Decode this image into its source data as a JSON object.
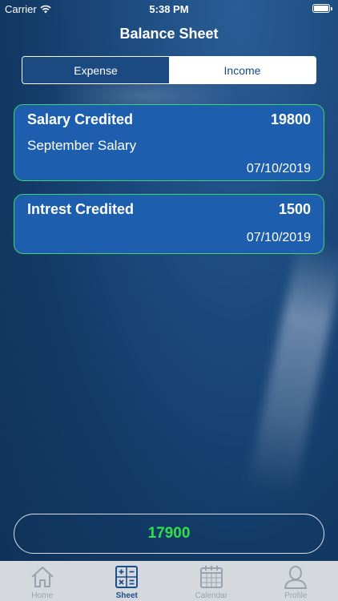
{
  "status_bar": {
    "carrier": "Carrier",
    "time": "5:38 PM"
  },
  "header": {
    "title": "Balance Sheet"
  },
  "segments": {
    "expense": "Expense",
    "income": "Income",
    "selected": "Income"
  },
  "entries": [
    {
      "title": "Salary Credited",
      "amount": "19800",
      "description": "September Salary",
      "date": "07/10/2019"
    },
    {
      "title": "Intrest Credited",
      "amount": "1500",
      "description": "",
      "date": "07/10/2019"
    }
  ],
  "total": "17900",
  "tabs": [
    {
      "label": "Home",
      "icon": "home-icon"
    },
    {
      "label": "Sheet",
      "icon": "calculator-icon"
    },
    {
      "label": "Calendar",
      "icon": "calendar-icon"
    },
    {
      "label": "Profile",
      "icon": "profile-icon"
    }
  ],
  "colors": {
    "accent": "#1d4e8c",
    "card_border": "#3ed46a",
    "total_text": "#2fe04a",
    "tab_inactive": "#9aa3ad"
  }
}
